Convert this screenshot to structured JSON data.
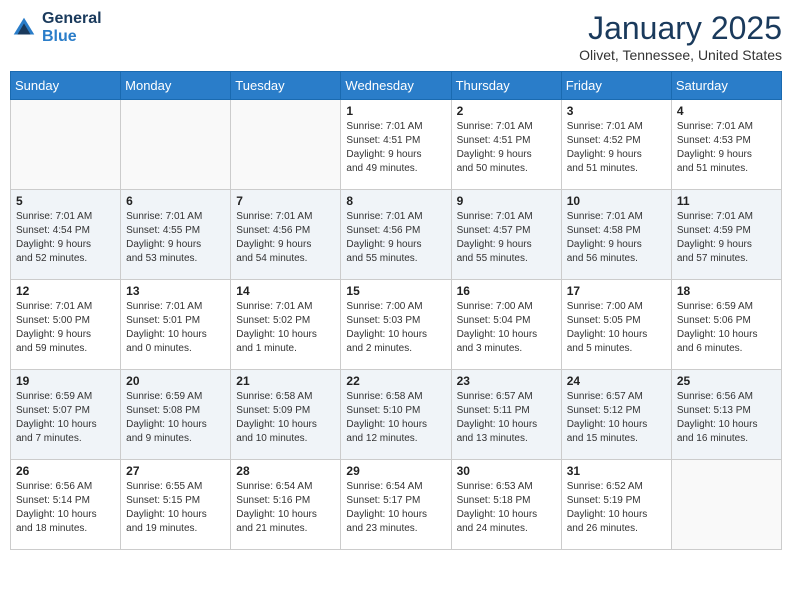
{
  "header": {
    "logo_general": "General",
    "logo_blue": "Blue",
    "month_title": "January 2025",
    "location": "Olivet, Tennessee, United States"
  },
  "weekdays": [
    "Sunday",
    "Monday",
    "Tuesday",
    "Wednesday",
    "Thursday",
    "Friday",
    "Saturday"
  ],
  "weeks": [
    {
      "days": [
        {
          "num": "",
          "info": ""
        },
        {
          "num": "",
          "info": ""
        },
        {
          "num": "",
          "info": ""
        },
        {
          "num": "1",
          "info": "Sunrise: 7:01 AM\nSunset: 4:51 PM\nDaylight: 9 hours\nand 49 minutes."
        },
        {
          "num": "2",
          "info": "Sunrise: 7:01 AM\nSunset: 4:51 PM\nDaylight: 9 hours\nand 50 minutes."
        },
        {
          "num": "3",
          "info": "Sunrise: 7:01 AM\nSunset: 4:52 PM\nDaylight: 9 hours\nand 51 minutes."
        },
        {
          "num": "4",
          "info": "Sunrise: 7:01 AM\nSunset: 4:53 PM\nDaylight: 9 hours\nand 51 minutes."
        }
      ]
    },
    {
      "days": [
        {
          "num": "5",
          "info": "Sunrise: 7:01 AM\nSunset: 4:54 PM\nDaylight: 9 hours\nand 52 minutes."
        },
        {
          "num": "6",
          "info": "Sunrise: 7:01 AM\nSunset: 4:55 PM\nDaylight: 9 hours\nand 53 minutes."
        },
        {
          "num": "7",
          "info": "Sunrise: 7:01 AM\nSunset: 4:56 PM\nDaylight: 9 hours\nand 54 minutes."
        },
        {
          "num": "8",
          "info": "Sunrise: 7:01 AM\nSunset: 4:56 PM\nDaylight: 9 hours\nand 55 minutes."
        },
        {
          "num": "9",
          "info": "Sunrise: 7:01 AM\nSunset: 4:57 PM\nDaylight: 9 hours\nand 55 minutes."
        },
        {
          "num": "10",
          "info": "Sunrise: 7:01 AM\nSunset: 4:58 PM\nDaylight: 9 hours\nand 56 minutes."
        },
        {
          "num": "11",
          "info": "Sunrise: 7:01 AM\nSunset: 4:59 PM\nDaylight: 9 hours\nand 57 minutes."
        }
      ]
    },
    {
      "days": [
        {
          "num": "12",
          "info": "Sunrise: 7:01 AM\nSunset: 5:00 PM\nDaylight: 9 hours\nand 59 minutes."
        },
        {
          "num": "13",
          "info": "Sunrise: 7:01 AM\nSunset: 5:01 PM\nDaylight: 10 hours\nand 0 minutes."
        },
        {
          "num": "14",
          "info": "Sunrise: 7:01 AM\nSunset: 5:02 PM\nDaylight: 10 hours\nand 1 minute."
        },
        {
          "num": "15",
          "info": "Sunrise: 7:00 AM\nSunset: 5:03 PM\nDaylight: 10 hours\nand 2 minutes."
        },
        {
          "num": "16",
          "info": "Sunrise: 7:00 AM\nSunset: 5:04 PM\nDaylight: 10 hours\nand 3 minutes."
        },
        {
          "num": "17",
          "info": "Sunrise: 7:00 AM\nSunset: 5:05 PM\nDaylight: 10 hours\nand 5 minutes."
        },
        {
          "num": "18",
          "info": "Sunrise: 6:59 AM\nSunset: 5:06 PM\nDaylight: 10 hours\nand 6 minutes."
        }
      ]
    },
    {
      "days": [
        {
          "num": "19",
          "info": "Sunrise: 6:59 AM\nSunset: 5:07 PM\nDaylight: 10 hours\nand 7 minutes."
        },
        {
          "num": "20",
          "info": "Sunrise: 6:59 AM\nSunset: 5:08 PM\nDaylight: 10 hours\nand 9 minutes."
        },
        {
          "num": "21",
          "info": "Sunrise: 6:58 AM\nSunset: 5:09 PM\nDaylight: 10 hours\nand 10 minutes."
        },
        {
          "num": "22",
          "info": "Sunrise: 6:58 AM\nSunset: 5:10 PM\nDaylight: 10 hours\nand 12 minutes."
        },
        {
          "num": "23",
          "info": "Sunrise: 6:57 AM\nSunset: 5:11 PM\nDaylight: 10 hours\nand 13 minutes."
        },
        {
          "num": "24",
          "info": "Sunrise: 6:57 AM\nSunset: 5:12 PM\nDaylight: 10 hours\nand 15 minutes."
        },
        {
          "num": "25",
          "info": "Sunrise: 6:56 AM\nSunset: 5:13 PM\nDaylight: 10 hours\nand 16 minutes."
        }
      ]
    },
    {
      "days": [
        {
          "num": "26",
          "info": "Sunrise: 6:56 AM\nSunset: 5:14 PM\nDaylight: 10 hours\nand 18 minutes."
        },
        {
          "num": "27",
          "info": "Sunrise: 6:55 AM\nSunset: 5:15 PM\nDaylight: 10 hours\nand 19 minutes."
        },
        {
          "num": "28",
          "info": "Sunrise: 6:54 AM\nSunset: 5:16 PM\nDaylight: 10 hours\nand 21 minutes."
        },
        {
          "num": "29",
          "info": "Sunrise: 6:54 AM\nSunset: 5:17 PM\nDaylight: 10 hours\nand 23 minutes."
        },
        {
          "num": "30",
          "info": "Sunrise: 6:53 AM\nSunset: 5:18 PM\nDaylight: 10 hours\nand 24 minutes."
        },
        {
          "num": "31",
          "info": "Sunrise: 6:52 AM\nSunset: 5:19 PM\nDaylight: 10 hours\nand 26 minutes."
        },
        {
          "num": "",
          "info": ""
        }
      ]
    }
  ]
}
